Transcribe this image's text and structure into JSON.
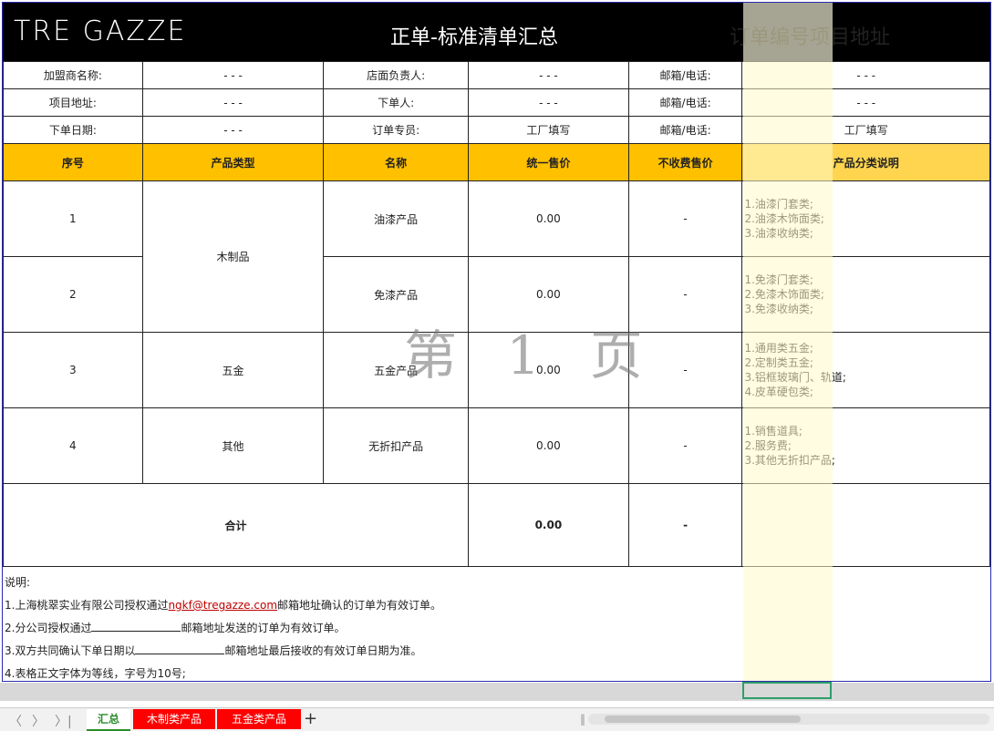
{
  "header": {
    "logo": "TRE GAZZE",
    "title": "正单-标准清单汇总",
    "order_label": "订单编号项目地址",
    "logo_colors": [
      "#009246",
      "#ffffff",
      "#ce2b37"
    ]
  },
  "info": [
    {
      "label1": "加盟商名称:",
      "val1": "- - -",
      "label2": "店面负责人:",
      "val2": "- - -",
      "label3": "邮箱/电话:",
      "val3": "- - -"
    },
    {
      "label1": "项目地址:",
      "val1": "- - -",
      "label2": "下单人:",
      "val2": "- - -",
      "label3": "邮箱/电话:",
      "val3": "- - -"
    },
    {
      "label1": "下单日期:",
      "val1": "- - -",
      "label2": "订单专员:",
      "val2": "工厂填写",
      "label3": "邮箱/电话:",
      "val3": "工厂填写"
    }
  ],
  "columns": [
    "序号",
    "产品类型",
    "名称",
    "统一售价",
    "不收费售价",
    "产品分类说明"
  ],
  "rows": [
    {
      "no": "1",
      "type": "木制品",
      "name": "油漆产品",
      "price": "0.00",
      "free": "-",
      "desc": [
        "1.油漆门套类;",
        "2.油漆木饰面类;",
        "3.油漆收纳类;"
      ]
    },
    {
      "no": "2",
      "type": "",
      "name": "免漆产品",
      "price": "0.00",
      "free": "-",
      "desc": [
        "1.免漆门套类;",
        "2.免漆木饰面类;",
        "3.免漆收纳类;"
      ]
    },
    {
      "no": "3",
      "type": "五金",
      "name": "五金产品",
      "price": "0.00",
      "free": "-",
      "desc": [
        "1.通用类五金;",
        "2.定制类五金;",
        "3.铝框玻璃门、轨道;",
        "4.皮革硬包类;"
      ]
    },
    {
      "no": "4",
      "type": "其他",
      "name": "无折扣产品",
      "price": "0.00",
      "free": "-",
      "desc": [
        "1.销售道具;",
        "2.服务费;",
        "3.其他无折扣产品;"
      ]
    }
  ],
  "total": {
    "label": "合计",
    "price": "0.00",
    "free": "-"
  },
  "notes": {
    "title": "说明:",
    "line1_pre": "1.上海桃翠实业有限公司授权通过",
    "line1_mail": "ngkf@tregazze.com",
    "line1_post": "邮箱地址确认的订单为有效订单。",
    "line2_pre": "2.分公司授权通过",
    "line2_post": "邮箱地址发送的订单为有效订单。",
    "line3_pre": "3.双方共同确认下单日期以",
    "line3_post": "邮箱地址最后接收的有效订单日期为准。",
    "line4": "4.表格正文字体为等线，字号为10号;"
  },
  "watermark": "第 1 页",
  "sheet_tabs": [
    "汇总",
    "木制类产品",
    "五金类产品"
  ],
  "add_tab": "+",
  "nav": {
    "prev": "〈",
    "next": "〉",
    "last": "〉|"
  }
}
